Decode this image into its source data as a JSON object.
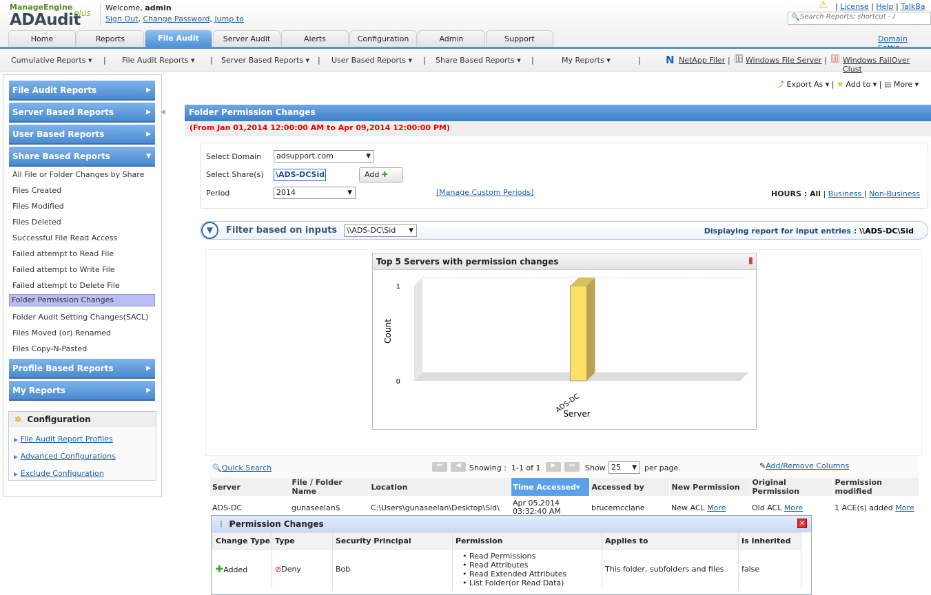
{
  "header": {
    "logo_brand": "ManageEngine",
    "logo_product": "ADAudit",
    "logo_plus": "plus",
    "welcome": "Welcome, ",
    "user": "admin",
    "links": [
      "Sign Out",
      "Change Password",
      "Jump to"
    ],
    "top_links": [
      "License",
      "Help",
      "TalkBa"
    ],
    "search_placeholder": "Search Reports; shortcut - /",
    "domain_settings": "Domain Settin"
  },
  "tabs": [
    "Home",
    "Reports",
    "File Audit",
    "Server Audit",
    "Alerts",
    "Configuration",
    "Admin",
    "Support"
  ],
  "active_tab": "File Audit",
  "subnav": [
    "Cumulative Reports",
    "File Audit Reports",
    "Server Based Reports",
    "User Based Reports",
    "Share Based Reports",
    "My Reports"
  ],
  "server_links": [
    "NetApp Filer",
    "Windows File Server",
    "Windows FailOver Clust"
  ],
  "actions": [
    "Export As",
    "Add to",
    "More"
  ],
  "sidebar": {
    "sections": [
      "File Audit Reports",
      "Server Based Reports",
      "User Based Reports",
      "Share Based Reports"
    ],
    "items": [
      "All File or Folder Changes by Share",
      "Files Created",
      "Files Modified",
      "Files Deleted",
      "Successful File Read Access",
      "Failed attempt to Read File",
      "Failed attempt to Write File",
      "Failed attempt to Delete File",
      "Folder Permission Changes",
      "Folder Audit Setting Changes(SACL)",
      "Files Moved (or) Renamed",
      "Files Copy-N-Pasted"
    ],
    "selected": "Folder Permission Changes",
    "sections2": [
      "Profile Based Reports",
      "My Reports"
    ],
    "config_title": "Configuration",
    "config_links": [
      "File Audit Report Profiles",
      "Advanced Configurations",
      "Exclude Configuration"
    ]
  },
  "report": {
    "title": "Folder Permission Changes",
    "range": "(From Jan 01,2014 12:00:00 AM to Apr 09,2014 12:00:00 PM)",
    "domain_label": "Select Domain",
    "domain": "adsupport.com",
    "share_label": "Select Share(s)",
    "share": "\\ADS-DCSid",
    "add": "Add",
    "period_label": "Period",
    "period": "2014",
    "manage_periods": "[Manage Custom Periods]",
    "hours_label": "HOURS : ",
    "hours_all": "All",
    "business": "Business ",
    "non_business": "Non-Business ",
    "filter_label": "Filter based on inputs",
    "filter_value": "\\\\ADS-DC\\Sid",
    "displaying_label": "Displaying report for input entries : ",
    "displaying_value": "\\\\ADS-DC\\Sid"
  },
  "chart_data": {
    "type": "bar",
    "title": "Top 5 Servers with permission changes",
    "categories": [
      "ADS-DC"
    ],
    "values": [
      1
    ],
    "xlabel": "Server",
    "ylabel": "Count",
    "ylim": [
      0,
      1
    ],
    "yticks": [
      "0",
      "1"
    ],
    "bar_color": "#ffe066"
  },
  "table": {
    "quick_search": "Quick Search",
    "showing": "Showing :",
    "range": "1-1 of 1",
    "show": "Show",
    "per_page_value": "25",
    "per_page": "per page.",
    "add_remove": "Add/Remove Columns",
    "columns": [
      "Server",
      "File / Folder Name",
      "Location",
      "Time Accessed",
      "Accessed by",
      "New Permission",
      "Original Permission",
      "Permission modified"
    ],
    "sorted_column": "Time Accessed",
    "rows": [
      {
        "server": "ADS-DC",
        "name": "gunaseelan$",
        "location": "C:\\Users\\gunaseelan\\Desktop\\Sid\\",
        "time1": "Apr 05,2014",
        "time2": "03:32:40 AM",
        "by": "brucemcclane",
        "newp": "New ACL",
        "origp": "Old ACL",
        "mod": "1 ACE(s) added",
        "more": "More"
      }
    ]
  },
  "popup": {
    "title": "Permission Changes",
    "columns": [
      "Change Type",
      "Type",
      "Security Principal",
      "Permission",
      "Applies to",
      "Is Inherited"
    ],
    "row": {
      "change": "Added",
      "type": "Deny",
      "principal": "Bob",
      "permissions": [
        "Read Permissions",
        "Read Attributes",
        "Read Extended Attributes",
        "List Folder(or Read Data)"
      ],
      "applies": "This folder, subfolders and files",
      "inherited": "false"
    }
  }
}
